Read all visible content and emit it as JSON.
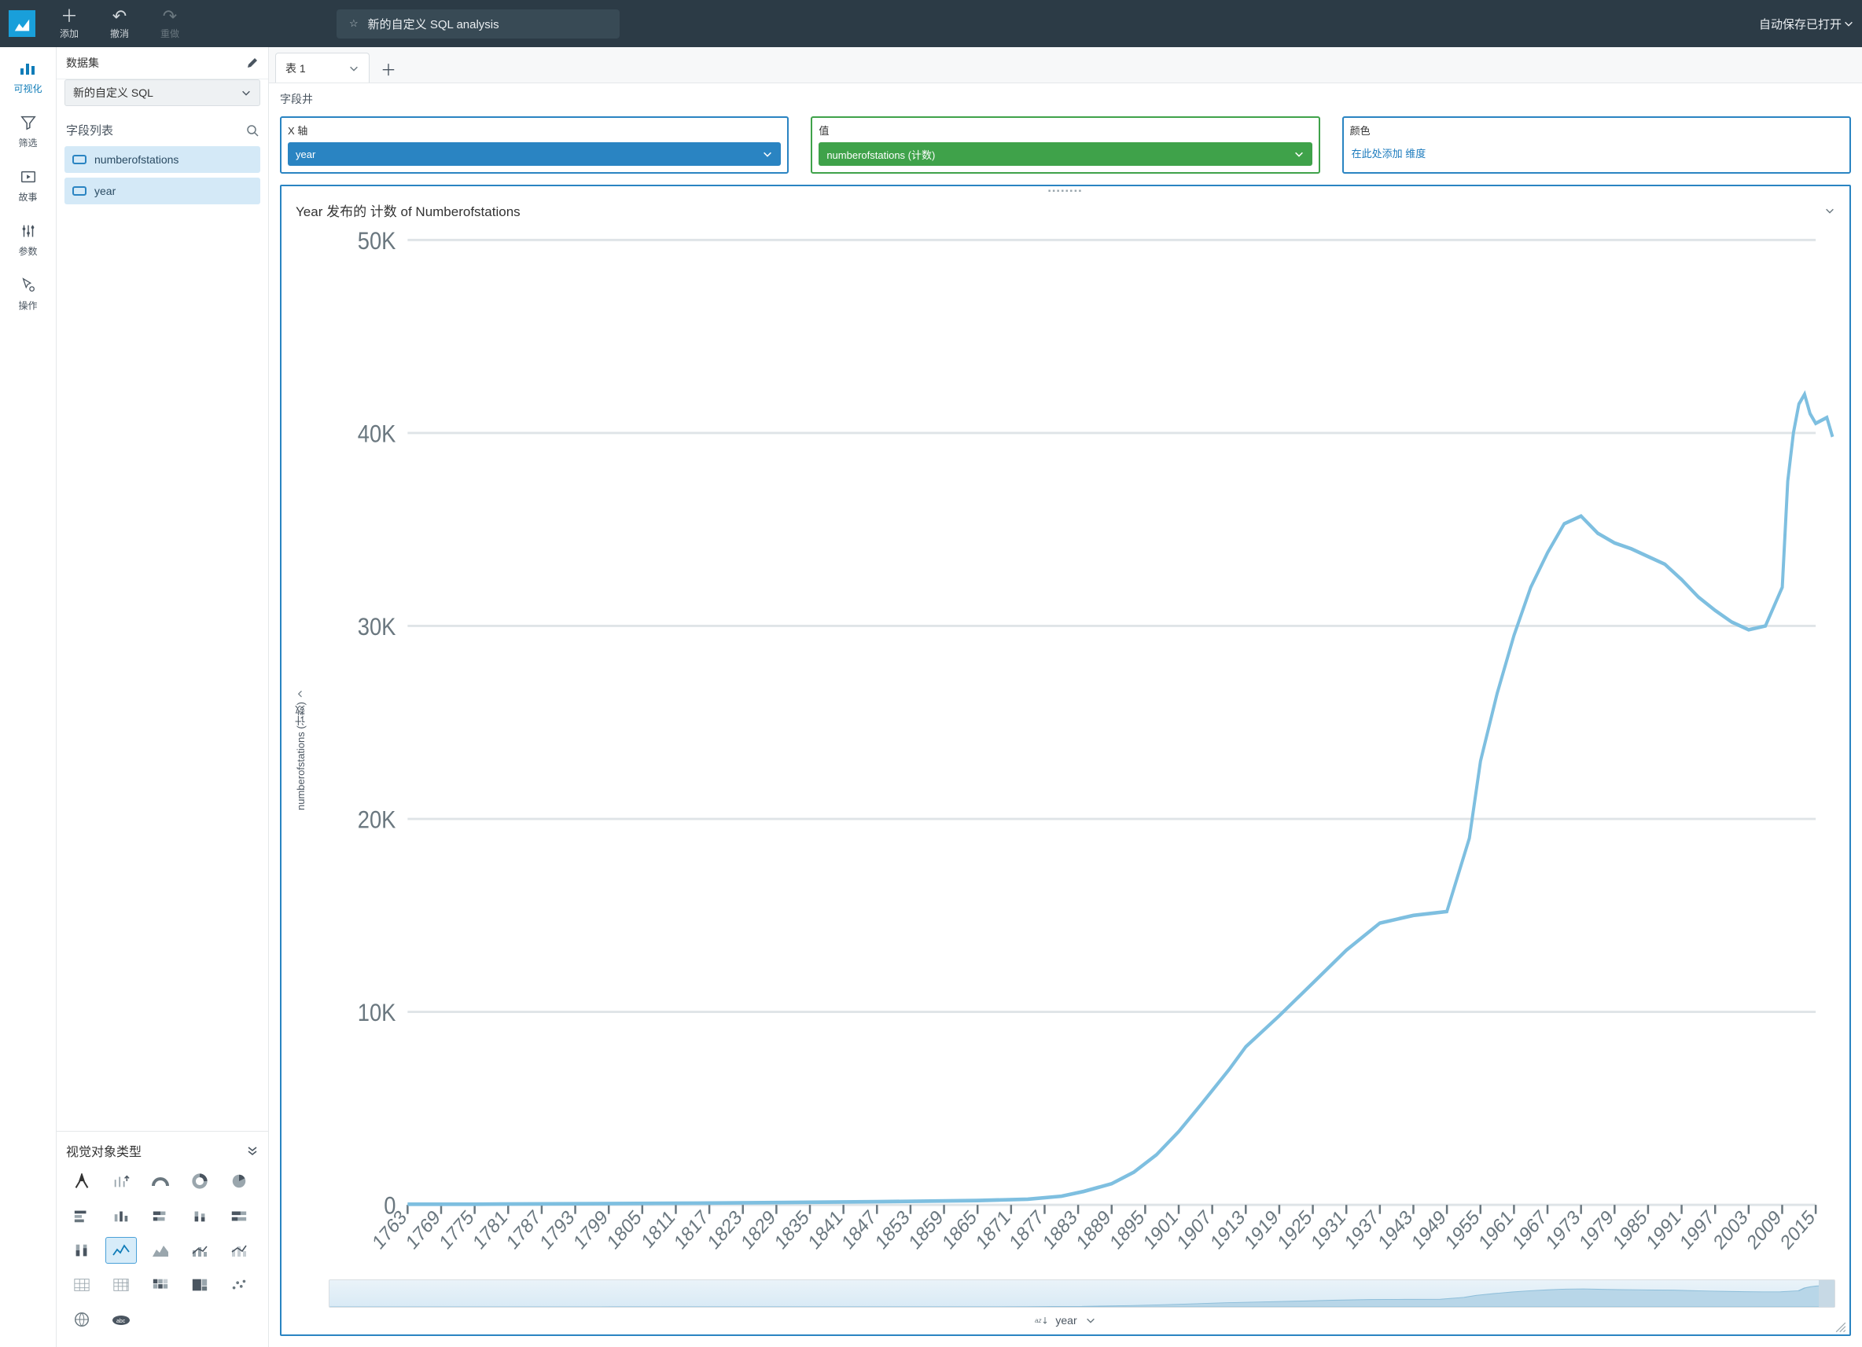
{
  "topbar": {
    "add_label": "添加",
    "undo_label": "撤消",
    "redo_label": "重做",
    "title": "新的自定义 SQL analysis",
    "autosave_label": "自动保存已打开"
  },
  "iconrail": {
    "visualize": "可视化",
    "filter": "筛选",
    "story": "故事",
    "parameters": "参数",
    "actions": "操作"
  },
  "datapanel": {
    "dataset_label": "数据集",
    "dataset_selected": "新的自定义 SQL",
    "fieldlist_label": "字段列表",
    "fields": [
      "numberofstations",
      "year"
    ],
    "visual_types_label": "视觉对象类型"
  },
  "tabs": {
    "tab1": "表 1"
  },
  "wells": {
    "field_wells_label": "字段井",
    "x_label": "X 轴",
    "value_label": "值",
    "color_label": "颜色",
    "x_value": "year",
    "value_value": "numberofstations (计数)",
    "color_placeholder": "在此处添加 维度"
  },
  "chart": {
    "title": "Year 发布的 计数 of Numberofstations",
    "ylabel": "numberofstations (计数)",
    "xlabel": "year"
  },
  "chart_data": {
    "type": "line",
    "title": "Year 发布的 计数 of Numberofstations",
    "xlabel": "year",
    "ylabel": "numberofstations (计数)",
    "ylim": [
      0,
      50000
    ],
    "yticks": [
      0,
      10000,
      20000,
      30000,
      40000,
      50000
    ],
    "ytick_labels": [
      "0",
      "10K",
      "20K",
      "30K",
      "40K",
      "50K"
    ],
    "xticks": [
      1763,
      1769,
      1775,
      1781,
      1787,
      1793,
      1799,
      1805,
      1811,
      1817,
      1823,
      1829,
      1835,
      1841,
      1847,
      1853,
      1859,
      1865,
      1871,
      1877,
      1883,
      1889,
      1895,
      1901,
      1907,
      1913,
      1919,
      1925,
      1931,
      1937,
      1943,
      1949,
      1955,
      1961,
      1967,
      1973,
      1979,
      1985,
      1991,
      1997,
      2003,
      2009,
      2015
    ],
    "x": [
      1763,
      1775,
      1793,
      1811,
      1829,
      1847,
      1865,
      1874,
      1880,
      1884,
      1889,
      1893,
      1897,
      1901,
      1905,
      1910,
      1913,
      1919,
      1925,
      1931,
      1937,
      1943,
      1949,
      1953,
      1955,
      1958,
      1961,
      1964,
      1967,
      1970,
      1973,
      1976,
      1979,
      1982,
      1985,
      1988,
      1991,
      1994,
      1997,
      2000,
      2003,
      2006,
      2009,
      2010,
      2011,
      2012,
      2013,
      2014,
      2015,
      2017,
      2018
    ],
    "y": [
      30,
      40,
      60,
      80,
      120,
      160,
      220,
      300,
      450,
      700,
      1100,
      1700,
      2600,
      3800,
      5200,
      7000,
      8200,
      9800,
      11500,
      13200,
      14600,
      15000,
      15200,
      19000,
      23000,
      26500,
      29500,
      32000,
      33800,
      35300,
      35700,
      34800,
      34300,
      34000,
      33600,
      33200,
      32400,
      31500,
      30800,
      30200,
      29800,
      30000,
      32000,
      37500,
      40000,
      41500,
      42000,
      41000,
      40500,
      40800,
      39800
    ]
  }
}
